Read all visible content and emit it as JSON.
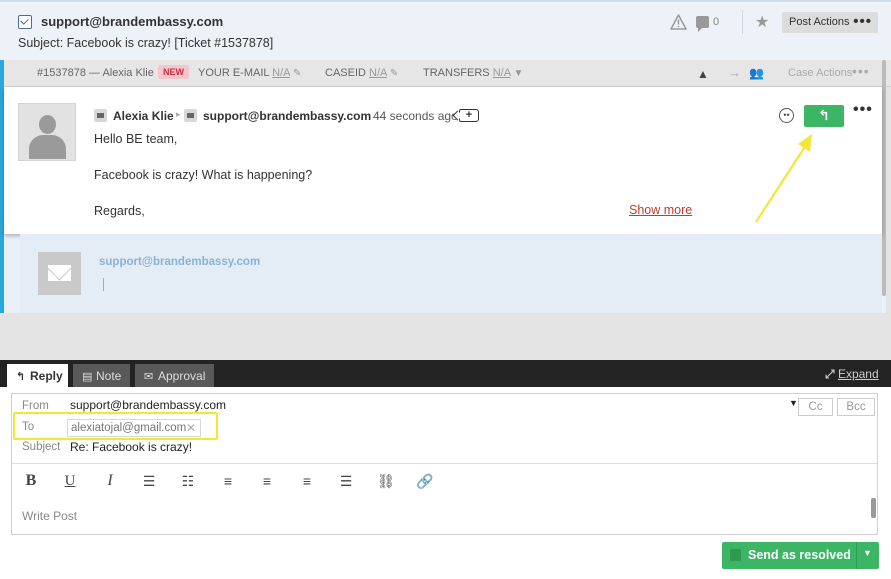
{
  "header": {
    "title": "support@brandembassy.com",
    "subject": "Subject: Facebook is crazy! [Ticket #1537878]",
    "comment_count": "0",
    "post_actions_label": "Post Actions"
  },
  "casebar": {
    "ticket": "#1537878 — Alexia Klie",
    "new_badge": "NEW",
    "fields": [
      {
        "label": "YOUR E-MAIL",
        "value": "N/A"
      },
      {
        "label": "CASEID",
        "value": "N/A"
      },
      {
        "label": "TRANSFERS",
        "value": "N/A"
      }
    ],
    "case_actions_label": "Case Actions"
  },
  "message": {
    "author": "Alexia Klie",
    "channel": "support@brandembassy.com",
    "time": "44 seconds ago",
    "lines": [
      "Hello BE team,",
      "Facebook is crazy! What is happening?",
      "Regards,"
    ],
    "show_more": "Show more"
  },
  "draft": {
    "sender": "support@brandembassy.com"
  },
  "composer": {
    "tabs": [
      {
        "label": "Reply",
        "active": true
      },
      {
        "label": "Note",
        "active": false
      },
      {
        "label": "Approval",
        "active": false
      }
    ],
    "expand_label": "Expand",
    "from_label": "From",
    "from_value": "support@brandembassy.com",
    "to_label": "To",
    "to_value": "alexiatojal@gmail.com",
    "subject_label": "Subject",
    "subject_value": "Re: Facebook is crazy!",
    "cc_label": "Cc",
    "bcc_label": "Bcc",
    "placeholder": "Write Post",
    "toolbar_icons": [
      "bold-icon",
      "underline-icon",
      "italic-icon",
      "bullet-list-icon",
      "numbered-list-icon",
      "align-left-icon",
      "align-center-icon",
      "align-right-icon",
      "align-justify-icon",
      "unlink-icon",
      "link-icon"
    ],
    "send_label": "Send as resolved"
  },
  "colors": {
    "accent_green": "#3cb564",
    "annotation_yellow": "#f2e637",
    "left_accent_blue": "#29a8df",
    "new_badge_red": "#d02b3e"
  }
}
